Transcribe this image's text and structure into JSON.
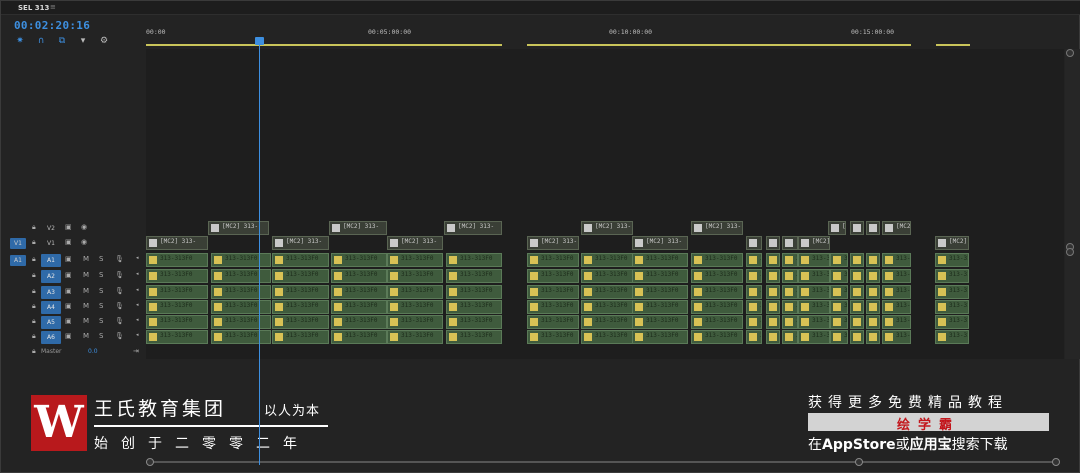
{
  "sequence": {
    "title": "SEL 313",
    "menu_icon": "menu-icon"
  },
  "timecode": "00:02:20:16",
  "tools": [
    {
      "name": "nest-icon",
      "glyph": "⟐"
    },
    {
      "name": "snap-icon",
      "glyph": "∩"
    },
    {
      "name": "linked-selection-icon",
      "glyph": "⧉"
    },
    {
      "name": "add-marker-icon",
      "glyph": "▼"
    },
    {
      "name": "wrench-icon",
      "glyph": "🔧"
    }
  ],
  "ruler": [
    "00:00",
    "00:05:00:00",
    "00:10:00:00",
    "00:15:00:00"
  ],
  "tracks": {
    "video": [
      {
        "name": "V2",
        "src": ""
      },
      {
        "name": "V1",
        "src": "V1"
      }
    ],
    "audio": [
      {
        "name": "A1",
        "src": "A1"
      },
      {
        "name": "A2",
        "src": ""
      },
      {
        "name": "A3",
        "src": ""
      },
      {
        "name": "A4",
        "src": ""
      },
      {
        "name": "A5",
        "src": ""
      },
      {
        "name": "A6",
        "src": ""
      }
    ],
    "mute": "M",
    "solo": "S"
  },
  "clip_labels": {
    "video": "[MC2] 313-",
    "audio": "313-313F0"
  },
  "master": {
    "label": "Master",
    "value": "0.0"
  },
  "watermark": {
    "brand_name": "王氏教育集团",
    "motto": "以人为本",
    "since": "始创于二零零二年",
    "promo_top": "获得更多免费精品教程",
    "promo_box": "绘学霸",
    "promo_bottom_pre": "在",
    "promo_bottom_store": "AppStore",
    "promo_bottom_mid": "或",
    "promo_bottom_app": "应用宝",
    "promo_bottom_post": "搜索下载"
  }
}
